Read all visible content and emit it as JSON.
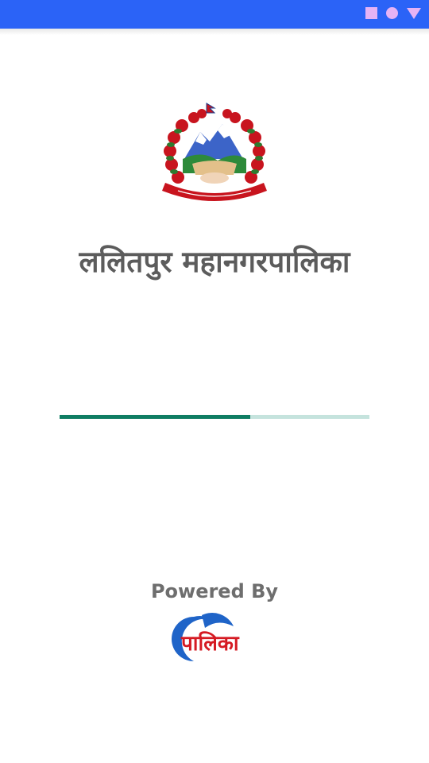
{
  "status_bar": {
    "icons": [
      "square-icon",
      "circle-icon",
      "triangle-icon"
    ],
    "background": "#2b63f7",
    "icon_color": "#e6b3f5"
  },
  "header": {
    "emblem_icon": "nepal-emblem-icon",
    "title": "ललितपुर महानगरपालिका"
  },
  "loading": {
    "progress_percent": 61.5,
    "fill_color": "#0f7d63",
    "track_color": "#c5e3dd"
  },
  "footer": {
    "powered_by": "Powered By",
    "logo_text": "पालिका",
    "logo_icon": "palika-logo-icon"
  }
}
